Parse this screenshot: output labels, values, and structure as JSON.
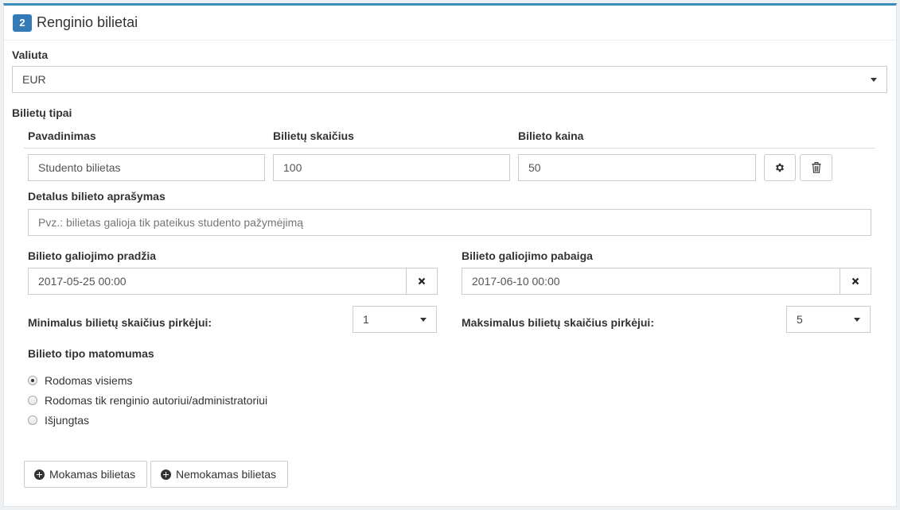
{
  "panel": {
    "step": "2",
    "title": "Renginio bilietai"
  },
  "currency": {
    "label": "Valiuta",
    "value": "EUR"
  },
  "ticket_types": {
    "label": "Bilietų tipai",
    "col_name": "Pavadinimas",
    "col_count": "Bilietų skaičius",
    "col_price": "Bilieto kaina",
    "name_value": "Studento bilietas",
    "count_value": "100",
    "price_value": "50",
    "description_label": "Detalus bilieto aprašymas",
    "description_placeholder": "Pvz.: bilietas galioja tik pateikus studento pažymėjimą",
    "start_label": "Bilieto galiojimo pradžia",
    "start_value": "2017-05-25 00:00",
    "end_label": "Bilieto galiojimo pabaiga",
    "end_value": "2017-06-10 00:00",
    "min_label": "Minimalus bilietų skaičius pirkėjui:",
    "min_value": "1",
    "max_label": "Maksimalus bilietų skaičius pirkėjui:",
    "max_value": "5",
    "visibility_label": "Bilieto tipo matomumas",
    "visibility_options": [
      "Rodomas visiems",
      "Rodomas tik renginio autoriui/administratoriui",
      "Išjungtas"
    ],
    "visibility_selected": 0
  },
  "actions": {
    "paid_ticket": "Mokamas bilietas",
    "free_ticket": "Nemokamas bilietas"
  },
  "icons": {
    "settings": "gear-icon",
    "delete": "trash-icon",
    "clear": "close-icon",
    "add": "plus-circle-icon"
  },
  "colors": {
    "accent": "#3c8dbc",
    "badge": "#337ab7"
  }
}
